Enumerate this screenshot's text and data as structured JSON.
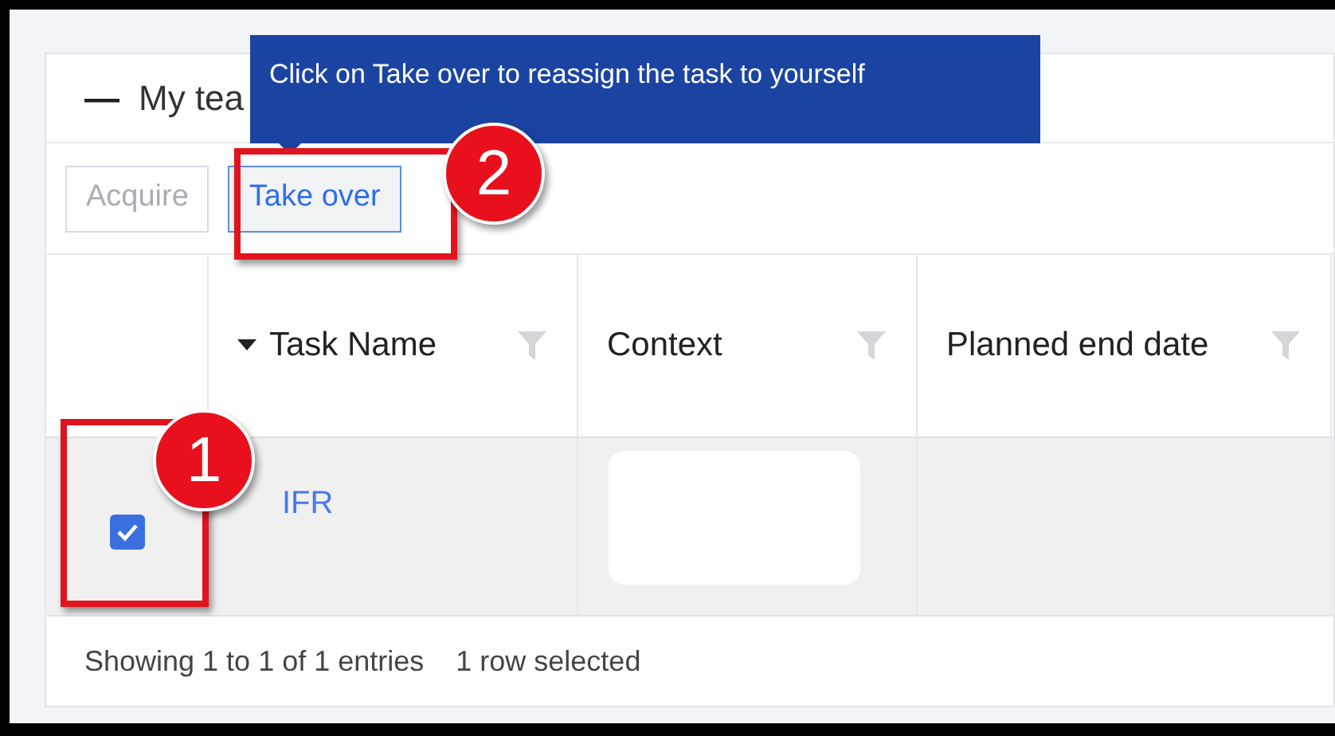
{
  "panel": {
    "collapse_icon": "—",
    "title": "My tea"
  },
  "toolbar": {
    "buttons": [
      {
        "label": "Acquire",
        "disabled": true
      },
      {
        "label": "Take over",
        "disabled": false
      }
    ]
  },
  "tooltip": "Click on Take over to reassign the task to yourself",
  "table": {
    "columns": [
      {
        "label": "Task Name",
        "sorted": true
      },
      {
        "label": "Context",
        "sorted": false
      },
      {
        "label": "Planned end date",
        "sorted": false
      }
    ],
    "rows": [
      {
        "checked": true,
        "task_name": "IFR"
      }
    ]
  },
  "footer": {
    "entries": "Showing 1 to 1 of 1 entries",
    "selection": "1 row selected"
  },
  "callouts": [
    "1",
    "2"
  ]
}
